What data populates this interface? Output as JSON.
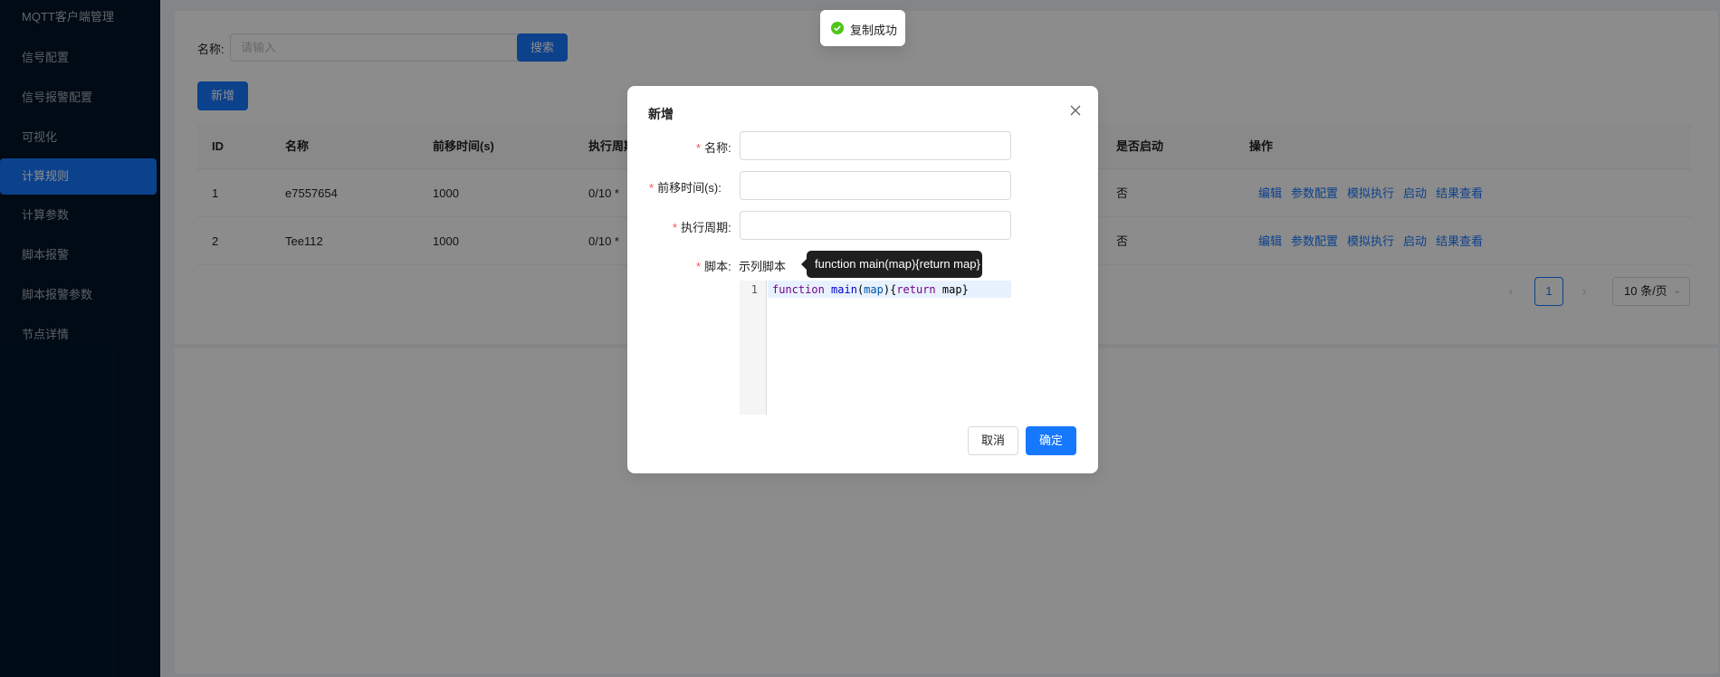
{
  "sidebar": {
    "title": "MQTT客户端管理",
    "items": [
      {
        "label": "信号配置",
        "active": false
      },
      {
        "label": "信号报警配置",
        "active": false
      },
      {
        "label": "可视化",
        "active": false
      },
      {
        "label": "计算规则",
        "active": true
      },
      {
        "label": "计算参数",
        "active": false
      },
      {
        "label": "脚本报警",
        "active": false
      },
      {
        "label": "脚本报警参数",
        "active": false
      },
      {
        "label": "节点详情",
        "active": false
      }
    ]
  },
  "search": {
    "label": "名称:",
    "placeholder": "请输入",
    "button": "搜索"
  },
  "toolbar": {
    "add_label": "新增"
  },
  "table": {
    "columns": [
      "ID",
      "名称",
      "前移时间(s)",
      "执行周期",
      "是否启动",
      "操作"
    ],
    "rows": [
      {
        "id": "1",
        "name": "e7557654",
        "offset": "1000",
        "period": "0/10 *",
        "enabled": "否"
      },
      {
        "id": "2",
        "name": "Tee112",
        "offset": "1000",
        "period": "0/10 *",
        "enabled": "否"
      }
    ],
    "actions": [
      "编辑",
      "参数配置",
      "模拟执行",
      "启动",
      "结果查看"
    ]
  },
  "pagination": {
    "current": "1",
    "page_size": "10 条/页"
  },
  "modal": {
    "title": "新增",
    "fields": {
      "name_label": "名称:",
      "offset_label": "前移时间(s):",
      "period_label": "执行周期:",
      "script_label": "脚本:"
    },
    "sample_link": "示列脚本",
    "tooltip": "function main(map){return map}",
    "editor": {
      "line_number": "1",
      "code": {
        "kw1": "function",
        "fn": "main",
        "arg": "map",
        "kw2": "return",
        "ret": "map"
      }
    },
    "cancel_label": "取消",
    "ok_label": "确定"
  },
  "toast": {
    "text": "复制成功"
  },
  "colors": {
    "primary": "#1677ff",
    "sidebar_bg": "#001529",
    "success": "#52c41a",
    "required": "#ff4d4f"
  }
}
